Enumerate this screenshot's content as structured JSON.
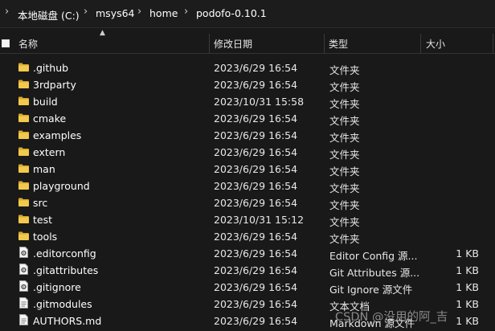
{
  "breadcrumb": {
    "items": [
      "本地磁盘 (C:)",
      "msys64",
      "home",
      "podofo-0.10.1"
    ],
    "separator": "›"
  },
  "columns": {
    "name": "名称",
    "date": "修改日期",
    "type": "类型",
    "size": "大小"
  },
  "files": [
    {
      "name": ".github",
      "date": "2023/6/29 16:54",
      "type": "文件夹",
      "size": "",
      "icon": "folder-icon"
    },
    {
      "name": "3rdparty",
      "date": "2023/6/29 16:54",
      "type": "文件夹",
      "size": "",
      "icon": "folder-icon"
    },
    {
      "name": "build",
      "date": "2023/10/31 15:58",
      "type": "文件夹",
      "size": "",
      "icon": "folder-icon"
    },
    {
      "name": "cmake",
      "date": "2023/6/29 16:54",
      "type": "文件夹",
      "size": "",
      "icon": "folder-icon"
    },
    {
      "name": "examples",
      "date": "2023/6/29 16:54",
      "type": "文件夹",
      "size": "",
      "icon": "folder-icon"
    },
    {
      "name": "extern",
      "date": "2023/6/29 16:54",
      "type": "文件夹",
      "size": "",
      "icon": "folder-icon"
    },
    {
      "name": "man",
      "date": "2023/6/29 16:54",
      "type": "文件夹",
      "size": "",
      "icon": "folder-icon"
    },
    {
      "name": "playground",
      "date": "2023/6/29 16:54",
      "type": "文件夹",
      "size": "",
      "icon": "folder-icon"
    },
    {
      "name": "src",
      "date": "2023/6/29 16:54",
      "type": "文件夹",
      "size": "",
      "icon": "folder-icon"
    },
    {
      "name": "test",
      "date": "2023/10/31 15:12",
      "type": "文件夹",
      "size": "",
      "icon": "folder-icon"
    },
    {
      "name": "tools",
      "date": "2023/6/29 16:54",
      "type": "文件夹",
      "size": "",
      "icon": "folder-icon"
    },
    {
      "name": ".editorconfig",
      "date": "2023/6/29 16:54",
      "type": "Editor Config 源...",
      "size": "1 KB",
      "icon": "config-file-icon"
    },
    {
      "name": ".gitattributes",
      "date": "2023/6/29 16:54",
      "type": "Git Attributes 源...",
      "size": "1 KB",
      "icon": "config-file-icon"
    },
    {
      "name": ".gitignore",
      "date": "2023/6/29 16:54",
      "type": "Git Ignore 源文件",
      "size": "1 KB",
      "icon": "config-file-icon"
    },
    {
      "name": ".gitmodules",
      "date": "2023/6/29 16:54",
      "type": "文本文档",
      "size": "1 KB",
      "icon": "text-file-icon"
    },
    {
      "name": "AUTHORS.md",
      "date": "2023/6/29 16:54",
      "type": "Markdown 源文件",
      "size": "1 KB",
      "icon": "text-file-icon"
    }
  ],
  "watermark": "CSDN @没用的阿_吉",
  "colors": {
    "background": "#191919",
    "folder": "#f2c94c",
    "folder_dark": "#d9a82e"
  }
}
